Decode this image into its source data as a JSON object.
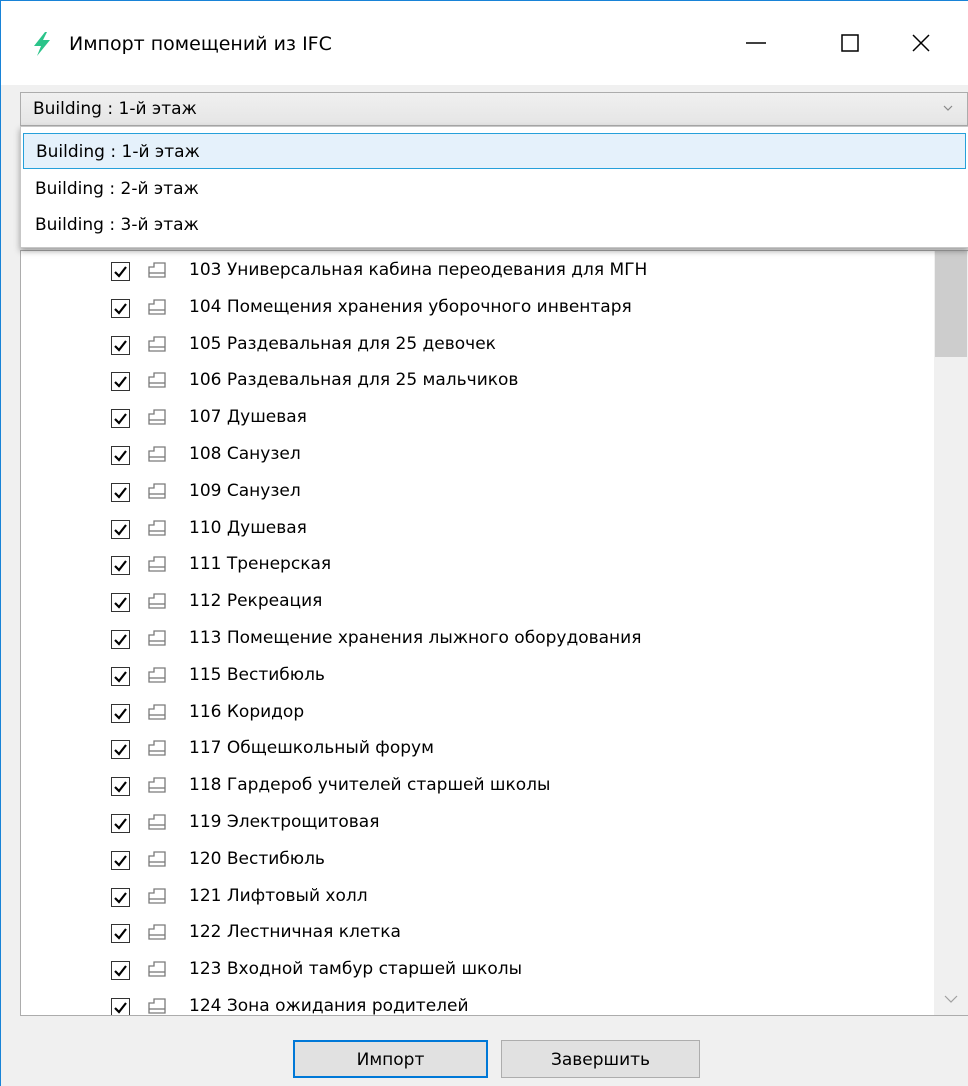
{
  "window": {
    "title": "Импорт помещений из IFC"
  },
  "combo": {
    "selected": "Building : 1-й этаж"
  },
  "dropdown": {
    "options": [
      {
        "label": "Building : 1-й этаж",
        "selected": true
      },
      {
        "label": "Building : 2-й этаж",
        "selected": false
      },
      {
        "label": "Building : 3-й этаж",
        "selected": false
      }
    ]
  },
  "rooms": [
    {
      "label": "103 Универсальная кабина переодевания для МГН",
      "checked": true
    },
    {
      "label": "104 Помещения хранения уборочного инвентаря",
      "checked": true
    },
    {
      "label": "105 Раздевальная для 25 девочек",
      "checked": true
    },
    {
      "label": "106 Раздевальная для 25 мальчиков",
      "checked": true
    },
    {
      "label": "107 Душевая",
      "checked": true
    },
    {
      "label": "108 Санузел",
      "checked": true
    },
    {
      "label": "109 Санузел",
      "checked": true
    },
    {
      "label": "110 Душевая",
      "checked": true
    },
    {
      "label": "111 Тренерская",
      "checked": true
    },
    {
      "label": "112 Рекреация",
      "checked": true
    },
    {
      "label": "113 Помещение хранения лыжного оборудования",
      "checked": true
    },
    {
      "label": "115 Вестибюль",
      "checked": true
    },
    {
      "label": "116 Коридор",
      "checked": true
    },
    {
      "label": "117 Общешкольный форум",
      "checked": true
    },
    {
      "label": "118 Гардероб учителей старшей школы",
      "checked": true
    },
    {
      "label": "119 Электрощитовая",
      "checked": true
    },
    {
      "label": "120 Вестибюль",
      "checked": true
    },
    {
      "label": "121 Лифтовый холл",
      "checked": true
    },
    {
      "label": "122 Лестничная клетка",
      "checked": true
    },
    {
      "label": "123 Входной тамбур старшей школы",
      "checked": true
    },
    {
      "label": "124 Зона ожидания родителей",
      "checked": true
    }
  ],
  "buttons": {
    "import_label": "Импорт",
    "finish_label": "Завершить"
  },
  "icons": {
    "app": "lightning-icon",
    "minimize": "minimize-icon",
    "maximize": "maximize-icon",
    "close": "close-icon",
    "room": "room-icon",
    "checkbox": "checkmark-icon"
  },
  "colors": {
    "accent": "#0078d7",
    "app_icon": "#2bc48a",
    "selection_bg": "#e5f1fb",
    "selection_border": "#26a0da"
  }
}
